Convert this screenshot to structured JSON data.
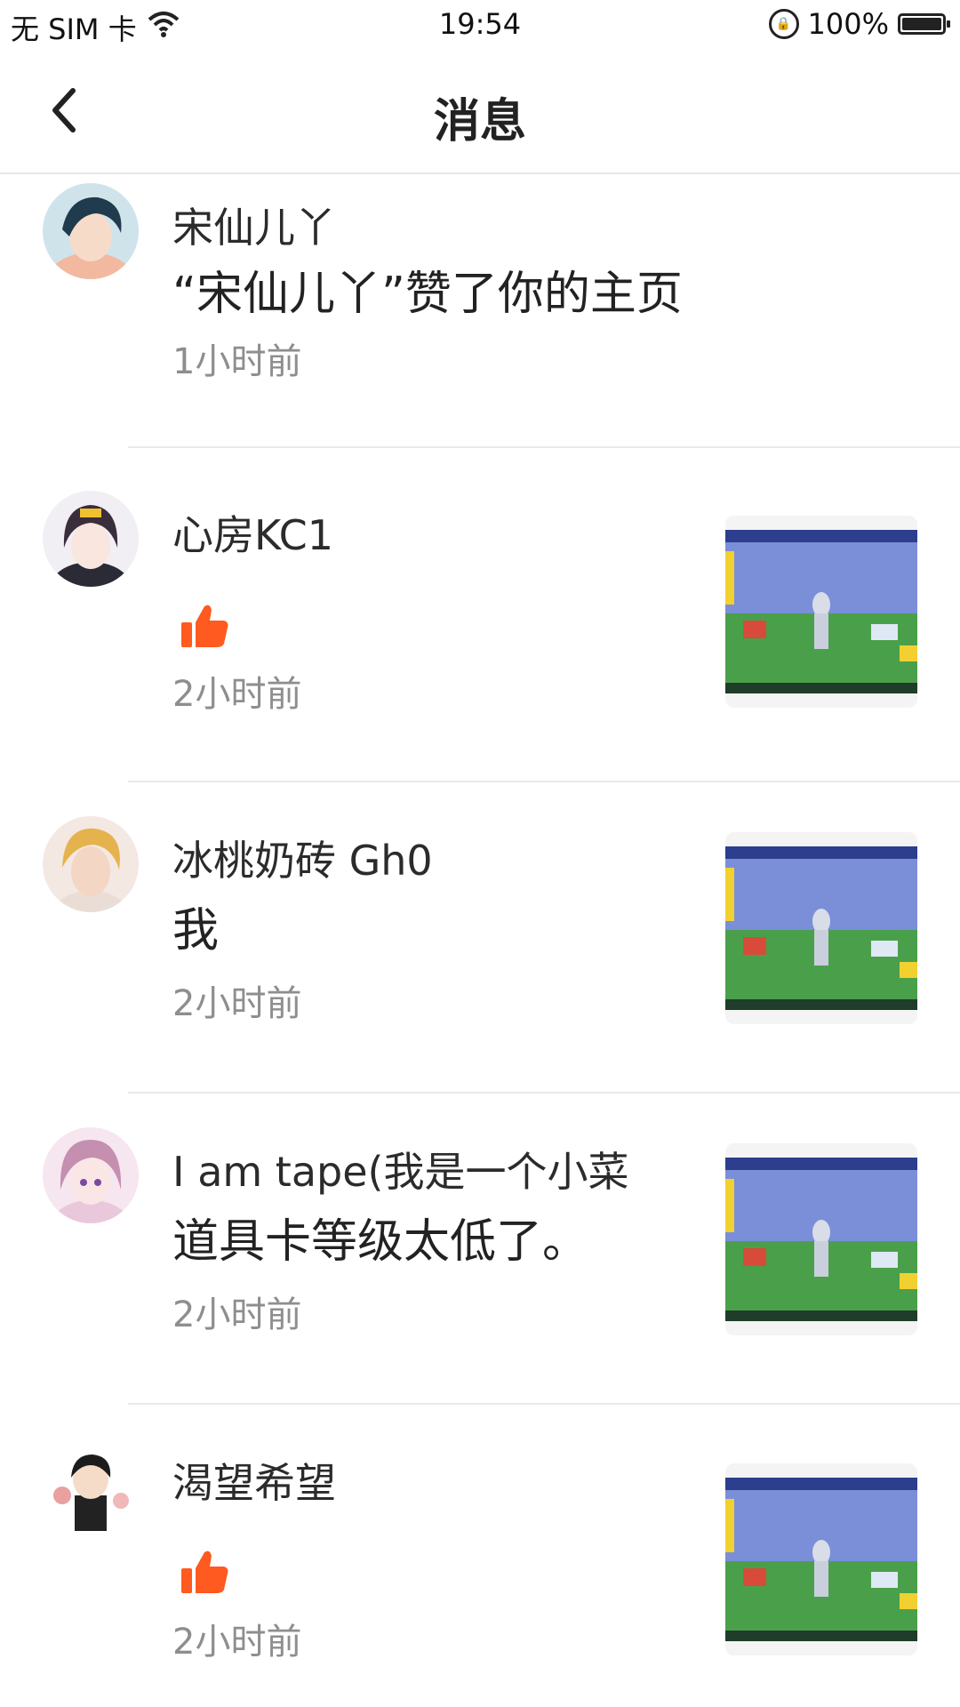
{
  "status_bar": {
    "carrier": "无 SIM 卡",
    "time": "19:54",
    "battery": "100%"
  },
  "header": {
    "title": "消息"
  },
  "messages": [
    {
      "name": "宋仙儿丫",
      "content": "“宋仙儿丫”赞了你的主页",
      "time": "1小时前",
      "type": "text",
      "avatar_icon": "avatar-boy-dark-hair"
    },
    {
      "name": "心房KC1",
      "content": "",
      "time": "2小时前",
      "type": "like",
      "avatar_icon": "avatar-anime-girl"
    },
    {
      "name": "冰桃奶砖 Gh0",
      "content": "我",
      "time": "2小时前",
      "type": "text",
      "avatar_icon": "avatar-blond-boy"
    },
    {
      "name": "I am tape(我是一个小菜",
      "content": "道具卡等级太低了。",
      "time": "2小时前",
      "type": "text",
      "avatar_icon": "avatar-pink-girl"
    },
    {
      "name": "渴望希望",
      "content": "",
      "time": "2小时前",
      "type": "like",
      "avatar_icon": "avatar-chibi-boy"
    }
  ],
  "colors": {
    "like": "#ff5a1f",
    "divider": "#e9e9e9",
    "time_text": "#8e8e8e"
  }
}
